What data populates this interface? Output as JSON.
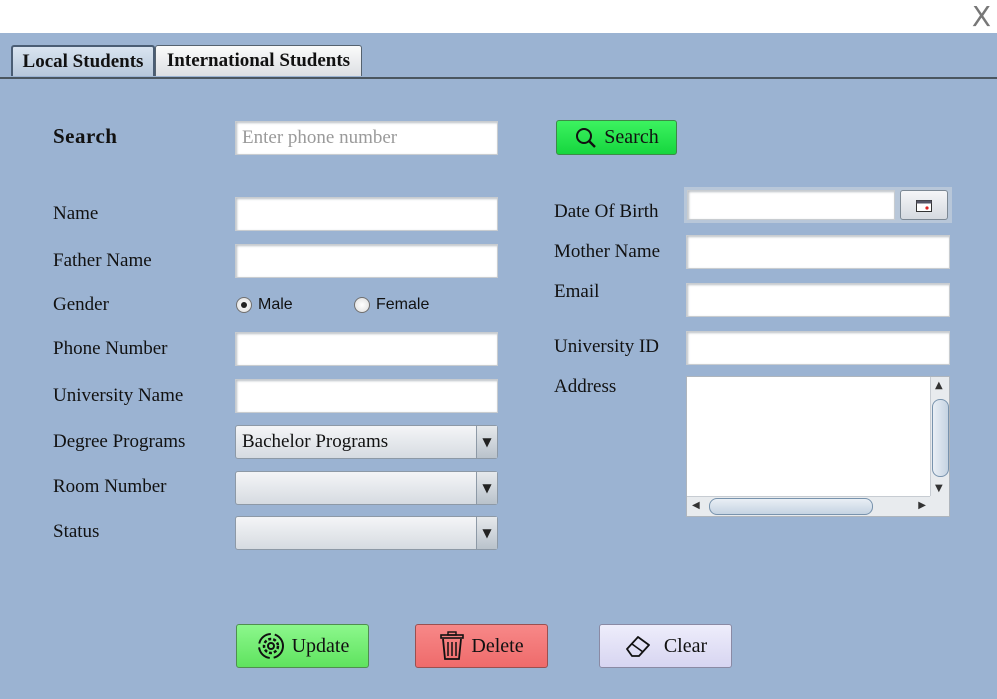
{
  "window": {
    "close_label": "X"
  },
  "tabs": [
    {
      "label": "Local Students",
      "active": true
    },
    {
      "label": "International Students",
      "active": false
    }
  ],
  "search": {
    "label": "Search",
    "placeholder": "Enter phone number",
    "button_label": "Search"
  },
  "left_form": {
    "name_label": "Name",
    "father_name_label": "Father Name",
    "gender_label": "Gender",
    "gender_options": [
      "Male",
      "Female"
    ],
    "gender_selected": "Male",
    "phone_label": "Phone Number",
    "university_name_label": "University Name",
    "degree_label": "Degree Programs",
    "degree_value": "Bachelor Programs",
    "room_label": "Room Number",
    "room_value": "",
    "status_label": "Status",
    "status_value": ""
  },
  "right_form": {
    "dob_label": "Date Of Birth",
    "mother_name_label": "Mother Name",
    "email_label": "Email",
    "university_id_label": "University ID",
    "address_label": "Address"
  },
  "actions": {
    "update_label": "Update",
    "delete_label": "Delete",
    "clear_label": "Clear"
  },
  "colors": {
    "background": "#9bb3d2",
    "search_button": "#22e04a",
    "update_button": "#7cf07c",
    "delete_button": "#f47b7b",
    "clear_button": "#e2e0f6"
  },
  "icons": {
    "search_button": "magnifier-icon",
    "update_button": "gear-refresh-icon",
    "delete_button": "trash-icon",
    "clear_button": "eraser-icon",
    "dob_button": "calendar-icon"
  }
}
